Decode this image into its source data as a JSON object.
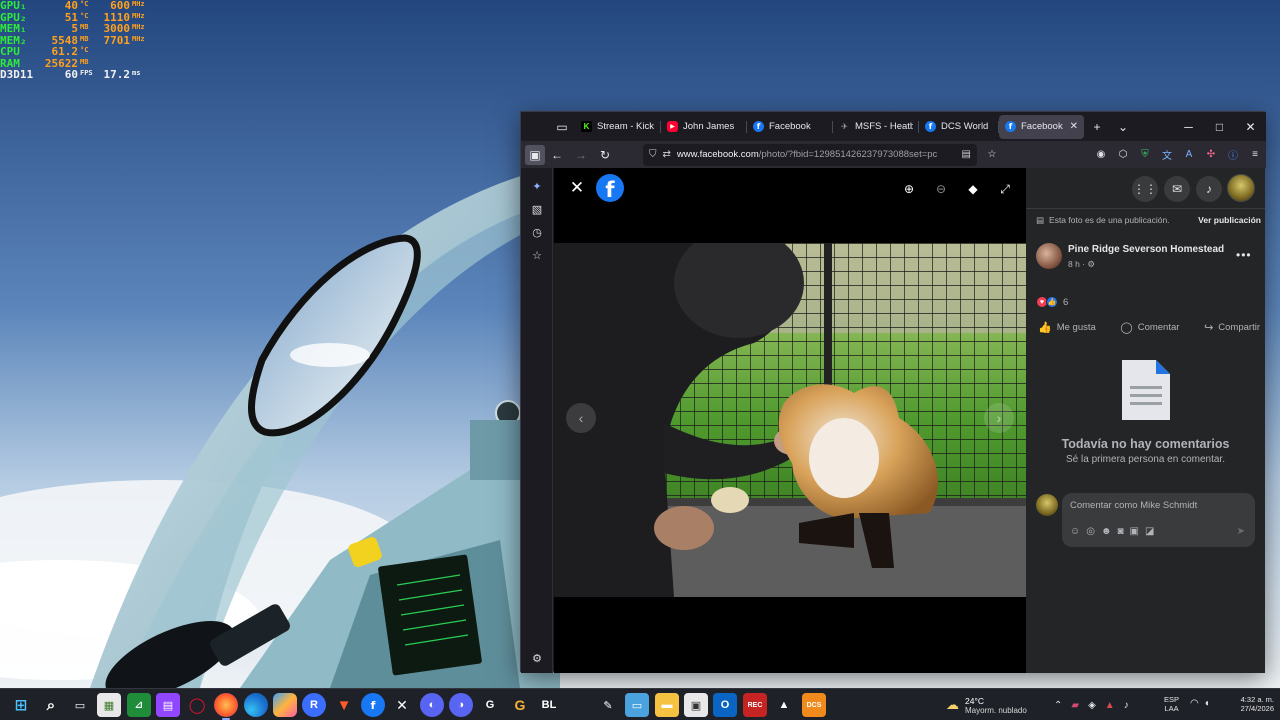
{
  "osd": {
    "rows": [
      {
        "label": "GPU₁",
        "v1": "40",
        "u1": "°C",
        "v2": "600",
        "u2": "MHz",
        "ghost": "",
        "style": "green"
      },
      {
        "label": "GPU₂",
        "v1": "51",
        "u1": "°C",
        "v2": "1110",
        "u2": "MHz",
        "ghost": "",
        "style": "green"
      },
      {
        "label": "MEM₁",
        "v1": "5",
        "u1": "MB",
        "v2": "3000",
        "u2": "MHz",
        "ghost": "",
        "style": "green"
      },
      {
        "label": "MEM₂",
        "v1": "5548",
        "u1": "MB",
        "v2": "7701",
        "u2": "MHz",
        "ghost": "",
        "style": "green"
      },
      {
        "label": "CPU",
        "v1": "61.2",
        "u1": "°C",
        "v2": "",
        "u2": "",
        "ghost": "",
        "style": "green"
      },
      {
        "label": "RAM",
        "v1": "25622",
        "u1": "MB",
        "v2": "",
        "u2": "",
        "ghost": "",
        "style": "green"
      },
      {
        "label": "D3D11",
        "v1": "60",
        "u1": "FPS",
        "v2": "17.2",
        "u2": "ms",
        "ghost": "",
        "style": "white"
      }
    ]
  },
  "browser": {
    "tabs": [
      {
        "title": "Stream - Kick De",
        "favicon": "kick",
        "active": false
      },
      {
        "title": "John James",
        "favicon": "youtube",
        "active": false
      },
      {
        "title": "Facebook",
        "favicon": "facebook",
        "active": false
      },
      {
        "title": "MSFS - Heatblur",
        "favicon": "msfs",
        "active": false
      },
      {
        "title": "DCS World",
        "favicon": "facebook",
        "active": false
      },
      {
        "title": "Facebook",
        "favicon": "facebook",
        "active": true
      }
    ],
    "url_host": "www.facebook.com",
    "url_path": "/photo/?fbid=129851426237973088set=pc"
  },
  "post": {
    "shared_note": "Esta foto es de una publicación.",
    "view_post_label": "Ver publicación",
    "page_name": "Pine Ridge Severson Homestead",
    "time": "8 h",
    "reaction_count": "6",
    "actions": {
      "like": "Me gusta",
      "comment": "Comentar",
      "share": "Compartir"
    },
    "no_comments_title": "Todavía no hay comentarios",
    "no_comments_sub": "Sé la primera persona en comentar.",
    "comment_placeholder": "Comentar como Mike Schmidt"
  },
  "taskbar": {
    "weather_temp": "24°C",
    "weather_desc": "Mayorm. nublado",
    "lang_line1": "ESP",
    "lang_line2": "LAA",
    "time": "4:32 a. m.",
    "date": "27/4/2026"
  },
  "colors": {
    "facebook_blue": "#1877f2",
    "panel_bg": "#242526",
    "osd_green": "#2eea3b",
    "osd_orange": "#ffa11c"
  }
}
